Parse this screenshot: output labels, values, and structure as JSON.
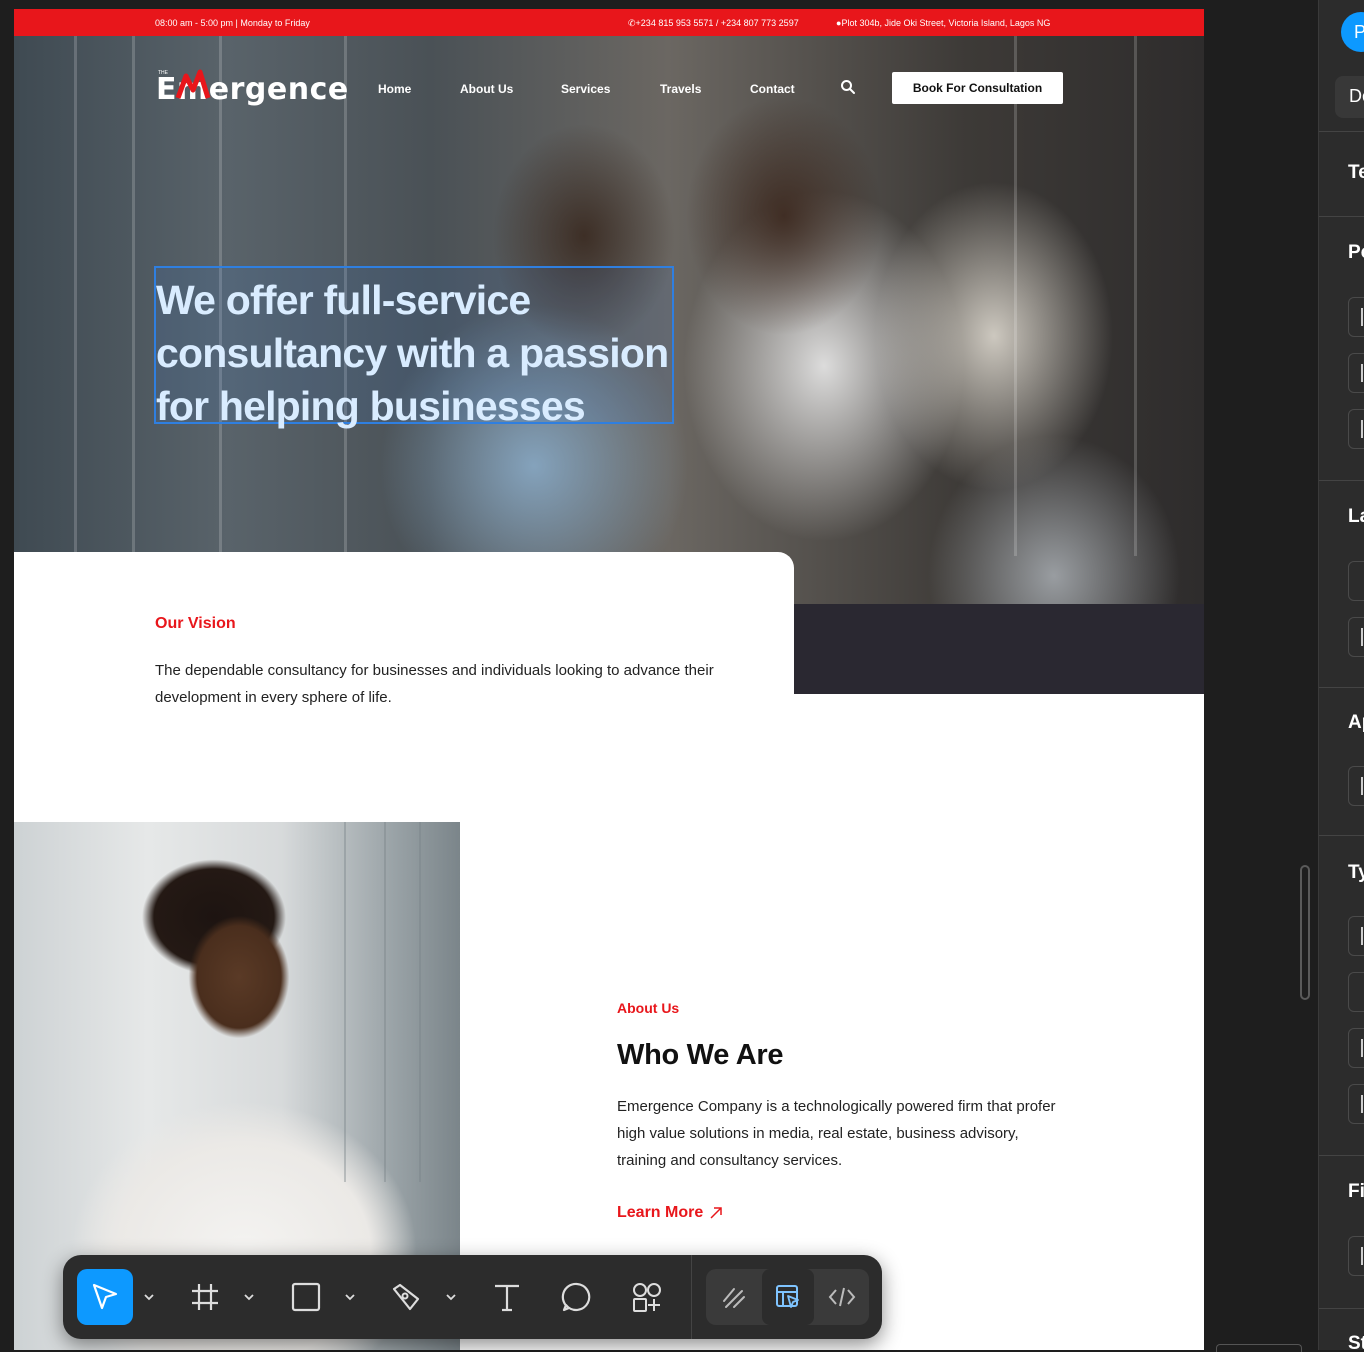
{
  "top_bar": {
    "hours": "08:00 am - 5:00 pm | Monday to Friday",
    "phone": "+234 815 953 5571 / +234 807 773 2597",
    "address": "Plot 304b, Jide Oki Street, Victoria Island, Lagos NG"
  },
  "brand": {
    "logo_small": "THE",
    "logo_text": "Emergence",
    "primary_color": "#e8161b"
  },
  "nav": {
    "items": [
      "Home",
      "About Us",
      "Services",
      "Travels",
      "Contact"
    ],
    "search_icon": "search-icon",
    "cta": "Book For Consultation"
  },
  "hero": {
    "headline_line1": "We offer full-service",
    "headline_line2": "consultancy with a passion",
    "headline_line3": "for helping businesses"
  },
  "vision": {
    "title": "Our Vision",
    "line1": "The dependable consultancy for businesses and individuals looking to advance their",
    "line2": "development in every sphere of life."
  },
  "about": {
    "eyebrow": "About Us",
    "title": "Who We Are",
    "line1": "Emergence Company is a technologically powered firm that profer",
    "line2": "high value solutions in media, real estate, business advisory,",
    "line3": "training and consultancy services.",
    "cta": "Learn More"
  },
  "toolbar": {
    "tools": [
      "move-tool",
      "frame-tool",
      "rectangle-tool",
      "pen-tool",
      "text-tool",
      "comment-tool",
      "components-tool"
    ],
    "modes": [
      "draw-mode",
      "design-mode",
      "dev-mode"
    ],
    "active_tool": "move-tool",
    "active_mode": "design-mode",
    "accent": "#0d99ff"
  },
  "right_panel": {
    "avatar_initial": "P",
    "pill": "De",
    "sections": [
      "Te",
      "Po",
      "La",
      "Ap",
      "Ty",
      "Fi",
      "St"
    ]
  }
}
